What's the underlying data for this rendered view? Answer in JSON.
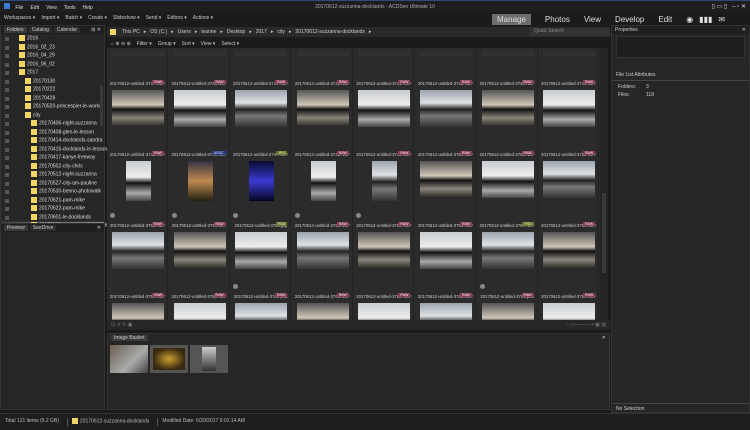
{
  "window": {
    "title": "20170612-suzzanna-docklands - ACDSee Ultimate 10"
  },
  "menu": [
    "File",
    "Edit",
    "View",
    "Tools",
    "Help"
  ],
  "toolbar": [
    "Workspaces ▾",
    "Import ▾",
    "Batch ▾",
    "Create ▾",
    "Slideshow ▾",
    "Send ▾",
    "Editors ▾",
    "Actions ▾"
  ],
  "modes": [
    {
      "label": "Manage",
      "active": true
    },
    {
      "label": "Photos"
    },
    {
      "label": "View"
    },
    {
      "label": "Develop"
    },
    {
      "label": "Edit"
    }
  ],
  "left_tabs": [
    "Folders",
    "Catalog",
    "Calendar"
  ],
  "folders": [
    {
      "name": "2016",
      "d": 1
    },
    {
      "name": "2016_02_23",
      "d": 1
    },
    {
      "name": "2016_04_29",
      "d": 1
    },
    {
      "name": "2016_06_02",
      "d": 1
    },
    {
      "name": "2017",
      "d": 1
    },
    {
      "name": "20170130",
      "d": 2
    },
    {
      "name": "20170222",
      "d": 2
    },
    {
      "name": "20170428",
      "d": 2
    },
    {
      "name": "20170520-princespier-le-works",
      "d": 2
    },
    {
      "name": "city",
      "d": 2
    },
    {
      "name": "20170406-night-suzzanna",
      "d": 3
    },
    {
      "name": "20170408-glen-le-lesson",
      "d": 3
    },
    {
      "name": "20170414-docklands-sandra",
      "d": 3
    },
    {
      "name": "20170415-docklands-le-lesson",
      "d": 3
    },
    {
      "name": "20170417-kanye-freeway",
      "d": 3
    },
    {
      "name": "20170502-city-chris",
      "d": 3
    },
    {
      "name": "20170512-night-suzzanna",
      "d": 3
    },
    {
      "name": "20170527-city-am-pauline",
      "d": 3
    },
    {
      "name": "20170530-benno-photowalk",
      "d": 3
    },
    {
      "name": "20170621-pam-mike",
      "d": 3
    },
    {
      "name": "20170622-pam-mike",
      "d": 3
    },
    {
      "name": "20170601-le-docklands",
      "d": 3
    },
    {
      "name": "20170612-suzzanna-docklands",
      "d": 3,
      "sel": true
    },
    {
      "name": "emmas-le-workshop",
      "d": 2
    }
  ],
  "preview_tabs": [
    "Preview",
    "SeeDrive"
  ],
  "breadcrumb": [
    "This PC",
    "OS (C:)",
    "Users",
    "leanne",
    "Desktop",
    "2017",
    "city",
    "20170612-suzzanna-docklands"
  ],
  "filterbar": [
    "Filter ▾",
    "Group ▾",
    "Sort ▾",
    "View ▾",
    "Select ▾"
  ],
  "search": {
    "placeholder": "Quick Search"
  },
  "grid": {
    "rows": [
      {
        "labels": [
          "20170612-untitled-3737.NEF",
          "20170612-untitled-3738.NEF",
          "20170612-untitled-3739.NEF",
          "20170612-untitled-3740.NEF",
          "20170612-untitled-3741.NEF",
          "20170612-untitled-3742.NEF",
          "20170612-untitled-3743.NEF",
          "20170612-untitled-3744.NEF"
        ],
        "badges": []
      },
      {
        "labels": [
          "20170612-untitled-3745.NEF",
          "20170612-untitled-3746.NEF",
          "20170612-untitled-3747.NEF",
          "20170612-untitled-3748.NEF",
          "20170612-untitled-3749.NEF",
          "20170612-untitled-3750.NEF",
          "20170612-untitled-3751.NEF",
          "20170612-untitled-3752.NEF"
        ],
        "badges": [
          "RAW",
          "RAW",
          "RAW",
          "RAW",
          "RAW",
          "RAW",
          "RAW",
          "RAW"
        ]
      },
      {
        "labels": [
          "20170612-untitled-3753.NEF",
          "20170612-untitled-3754.ac...",
          "20170612-untitled-3754.jpg",
          "20170612-untitled-3754.NEF",
          "20170612-untitled-3755.NEF",
          "20170612-untitled-3756.NEF",
          "20170612-untitled-3757.NEF",
          "20170612-untitled-3758.NEF"
        ],
        "badges": [
          "RAW",
          "ACDC",
          "JPG",
          "RAW",
          "RAW",
          "RAW",
          "RAW",
          "RAW"
        ]
      },
      {
        "labels": [
          "20170612-untitled-3759.NEF",
          "20170612-untitled-3760.NEF",
          "20170612-untitled-3760.psd",
          "20170612-untitled-3761.NEF",
          "20170612-untitled-3762.NEF",
          "20170612-untitled-3763.NEF",
          "20170612-untitled-3763.psd",
          "20170612-untitled-3764.NEF"
        ],
        "badges": [
          "RAW",
          "RAW",
          "PSD",
          "RAW",
          "RAW",
          "RAW",
          "PSD",
          "RAW"
        ]
      },
      {
        "labels": [],
        "badges": [
          "RAW",
          "RAW",
          "RAW",
          "RAW",
          "RAW",
          "RAW",
          "RAW",
          "RAW"
        ]
      }
    ]
  },
  "basket": {
    "title": "Image Basket"
  },
  "properties": {
    "title": "Properties",
    "section": "File List Attributes",
    "rows": [
      {
        "k": "Folders:",
        "v": "3"
      },
      {
        "k": "Files:",
        "v": "118"
      }
    ],
    "footer": "No Selection"
  },
  "status": {
    "total": "Total 121 items  (5.2 GB)",
    "folder": "20170612-suzzanna-docklands",
    "modified": "Modified Date: 6/20/2017 9:01:14 AM"
  },
  "colors": {
    "RAW": "#8a3a5a",
    "ACDC": "#2a3a8a",
    "JPG": "#6a7a2a",
    "PSD": "#6a7a2a",
    "accent": "#f2d564"
  }
}
